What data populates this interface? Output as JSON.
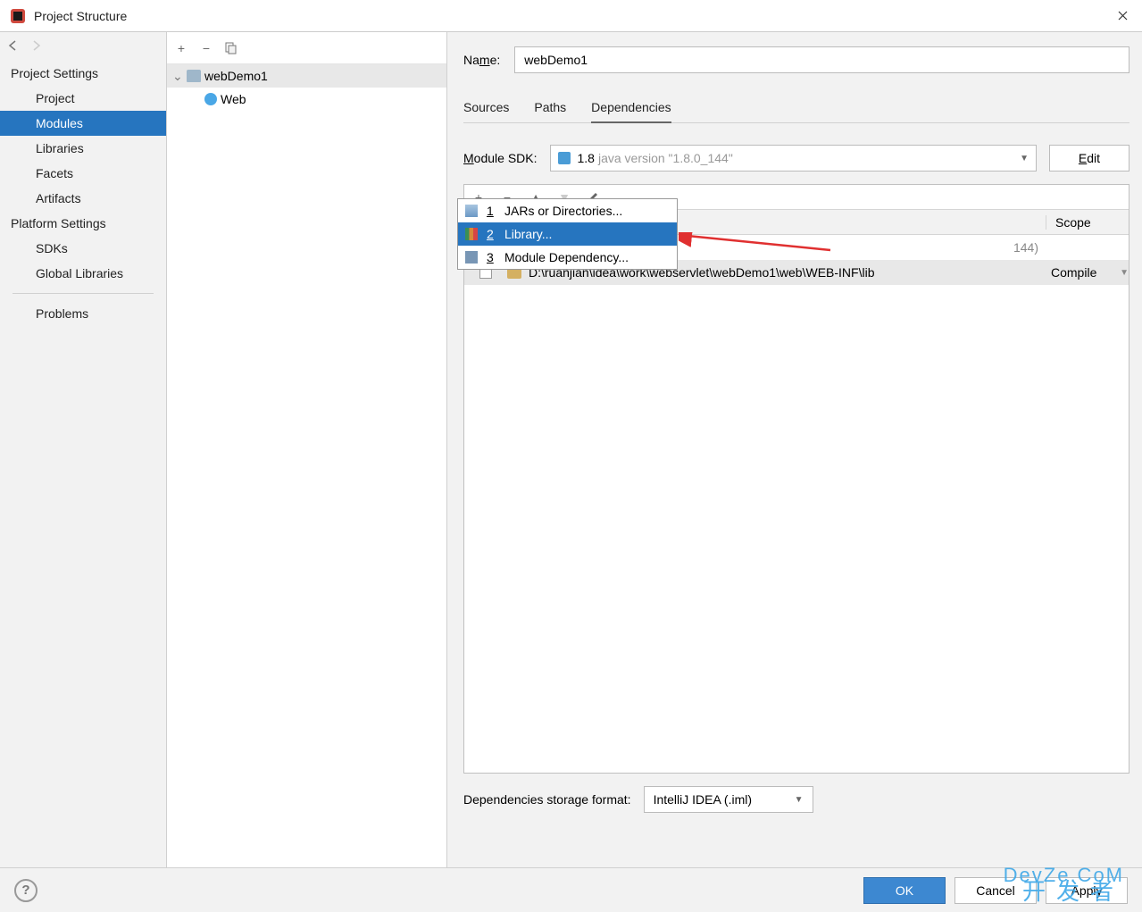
{
  "window": {
    "title": "Project Structure"
  },
  "sidebar": {
    "sections": [
      {
        "title": "Project Settings",
        "items": [
          "Project",
          "Modules",
          "Libraries",
          "Facets",
          "Artifacts"
        ]
      },
      {
        "title": "Platform Settings",
        "items": [
          "SDKs",
          "Global Libraries"
        ]
      }
    ],
    "selected": "Modules",
    "problems": "Problems"
  },
  "midpanel": {
    "tree": [
      {
        "label": "webDemo1",
        "children": [
          {
            "label": "Web"
          }
        ]
      }
    ]
  },
  "rightpanel": {
    "name_label": "Name:",
    "name_value": "webDemo1",
    "tabs": [
      "Sources",
      "Paths",
      "Dependencies"
    ],
    "active_tab": "Dependencies",
    "sdk_label": "Module SDK:",
    "sdk_name": "1.8",
    "sdk_version": "java version \"1.8.0_144\"",
    "edit_label": "Edit",
    "deps_header": {
      "scope": "Scope"
    },
    "deps_rows": [
      {
        "path_suffix": "144)",
        "scope": ""
      },
      {
        "path": "D:\\ruanjian\\idea\\work\\webservlet\\webDemo1\\web\\WEB-INF\\lib",
        "scope": "Compile"
      }
    ],
    "storage_label": "Dependencies storage format:",
    "storage_value": "IntelliJ IDEA (.iml)"
  },
  "popup": {
    "items": [
      {
        "key": "1",
        "label": "JARs or Directories...",
        "icon": "jars"
      },
      {
        "key": "2",
        "label": "Library...",
        "icon": "lib",
        "selected": true
      },
      {
        "key": "3",
        "label": "Module Dependency...",
        "icon": "mod"
      }
    ]
  },
  "footer": {
    "ok": "OK",
    "cancel": "Cancel",
    "apply": "Apply"
  },
  "watermark": {
    "chinese": "开发者",
    "latin": "DevZe.CoM"
  }
}
